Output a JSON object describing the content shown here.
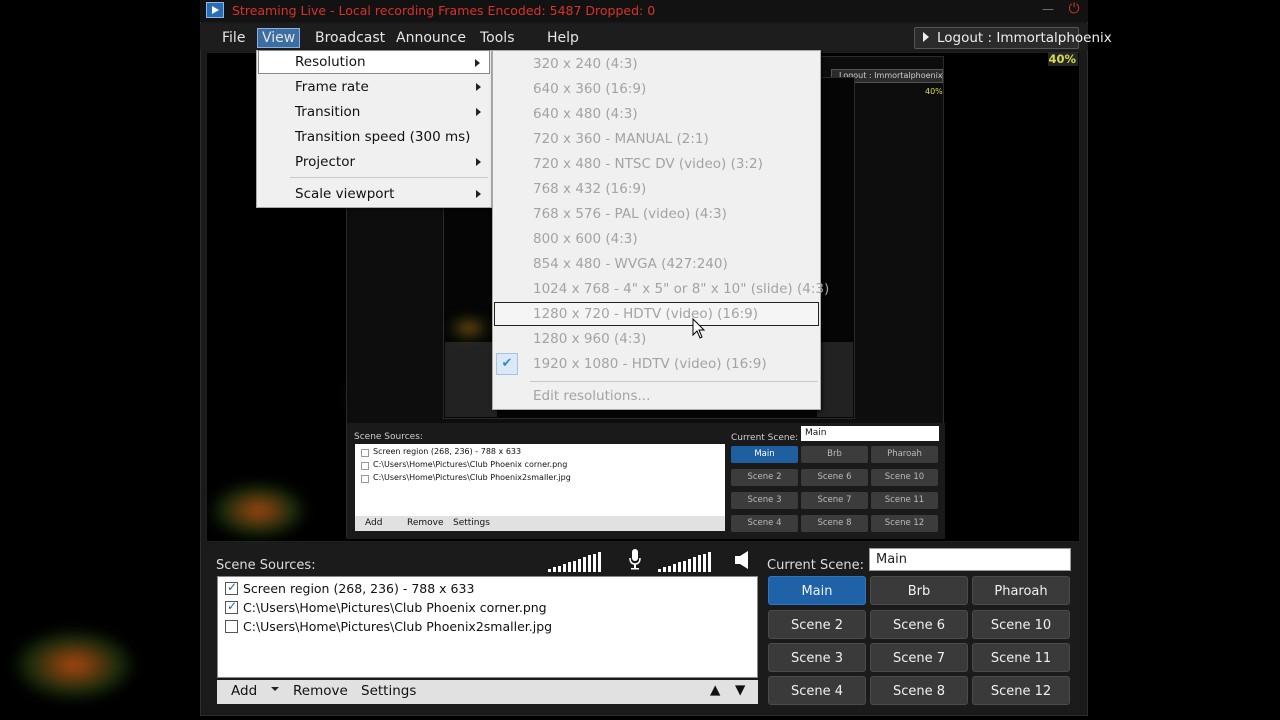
{
  "window": {
    "title": "Streaming Live - Local recording  Frames Encoded: 5487 Dropped: 0",
    "minimize_glyph": "—",
    "close_glyph": "⏻"
  },
  "menubar": {
    "items": [
      "File",
      "View",
      "Broadcast",
      "Announce",
      "Tools",
      "Help"
    ],
    "logout": "Logout : Immortalphoenix",
    "cpu": "40%"
  },
  "view_menu": {
    "items": [
      {
        "label": "Resolution",
        "submenu": true
      },
      {
        "label": "Frame rate",
        "submenu": true
      },
      {
        "label": "Transition",
        "submenu": true
      },
      {
        "label": "Transition speed (300 ms)",
        "submenu": false
      },
      {
        "label": "Projector",
        "submenu": true
      },
      {
        "label": "Scale viewport",
        "submenu": true
      }
    ]
  },
  "resolution_menu": {
    "items": [
      "320 x 240 (4:3)",
      "640 x 360 (16:9)",
      "640 x 480 (4:3)",
      "720 x 360 - MANUAL (2:1)",
      "720 x 480 - NTSC DV (video) (3:2)",
      "768 x 432 (16:9)",
      "768 x 576 - PAL (video) (4:3)",
      "800 x 600 (4:3)",
      "854 x 480 - WVGA (427:240)",
      "1024 x 768 - 4\" x 5\" or 8\" x 10\" (slide) (4:3)",
      "1280 x 720 - HDTV (video) (16:9)",
      "1280 x 960 (4:3)",
      "1920 x 1080 - HDTV (video) (16:9)"
    ],
    "edit": "Edit resolutions...",
    "checked": "1920 x 1080 - HDTV (video) (16:9)",
    "hovered": "1280 x 720 - HDTV (video) (16:9)",
    "check_glyph": "✔"
  },
  "nested": {
    "logout": "Logout : Immortalphoenix",
    "cpu": "40%",
    "scene_sources_label": "Scene Sources:",
    "current_scene_label": "Current Scene:",
    "current_scene_value": "Main",
    "tools": [
      "Add",
      "Remove",
      "Settings"
    ]
  },
  "scene_sources": {
    "label": "Scene Sources:",
    "items": [
      {
        "text": "Screen region (268, 236) - 788 x 633",
        "checked": true
      },
      {
        "text": "C:\\Users\\Home\\Pictures\\Club Phoenix corner.png",
        "checked": true
      },
      {
        "text": "C:\\Users\\Home\\Pictures\\Club Phoenix2smaller.jpg",
        "checked": false
      }
    ],
    "tools": {
      "add": "Add",
      "remove": "Remove",
      "settings": "Settings"
    },
    "up_glyph": "▲",
    "down_glyph": "▼"
  },
  "scenes": {
    "current_label": "Current Scene:",
    "current_value": "Main",
    "buttons": [
      [
        "Main",
        "Brb",
        "Pharoah"
      ],
      [
        "Scene 2",
        "Scene 6",
        "Scene 10"
      ],
      [
        "Scene 3",
        "Scene 7",
        "Scene 11"
      ],
      [
        "Scene 4",
        "Scene 8",
        "Scene 12"
      ]
    ],
    "selected": "Main"
  },
  "icons": {
    "mic": "mic-icon",
    "speaker": "speaker-icon",
    "app": "app-icon"
  },
  "colors": {
    "title_red": "#d9322b",
    "selected_blue": "#1f62a8",
    "cpu_yellow": "#d8dc4a"
  }
}
